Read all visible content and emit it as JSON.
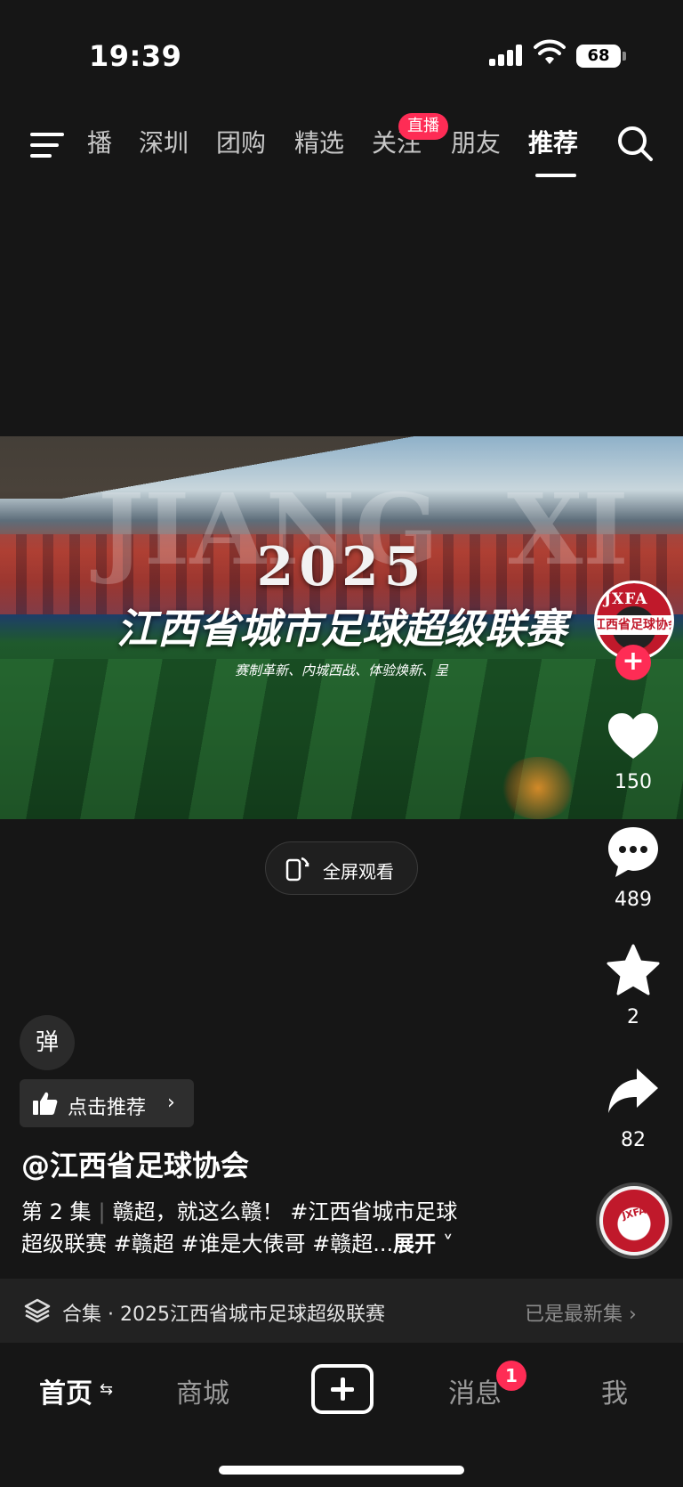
{
  "status_bar": {
    "time": "19:39",
    "battery": "68"
  },
  "top_nav": {
    "tabs": [
      "播",
      "深圳",
      "团购",
      "精选",
      "关注",
      "朋友",
      "推荐"
    ],
    "active_tab": "推荐",
    "live_badge": "直播"
  },
  "video": {
    "ghost_text_left": "JIANG",
    "ghost_text_right": "XI",
    "year": "2025",
    "headline": "江西省城市足球超级联赛",
    "tagline": "赛制革新、内城西战、体验焕新、呈"
  },
  "fullscreen_button": {
    "label": "全屏观看"
  },
  "avatar": {
    "crest_top": "JXFA",
    "crest_band": "江西省足球协会"
  },
  "actions": {
    "likes": "150",
    "comments": "489",
    "favorites": "2",
    "shares": "82"
  },
  "danmu_label": "弹",
  "recommend_button": {
    "label": "点击推荐",
    "chevron": "›"
  },
  "post": {
    "author": "@江西省足球协会",
    "episode": "第 2 集",
    "caption_line1": "赣超，就这么赣！ #江西省城市足球",
    "caption_line2": "超级联赛 #赣超 #谁是大俵哥 #赣超...",
    "expand_label": "展开"
  },
  "collection": {
    "title": "合集 · 2025江西省城市足球超级联赛",
    "status": "已是最新集"
  },
  "bottom_tabs": {
    "home": "首页",
    "home_arrow": "⇆",
    "mall": "商城",
    "messages": "消息",
    "message_badge": "1",
    "me": "我"
  },
  "colors": {
    "accent": "#fe2c55",
    "background": "#161616"
  }
}
